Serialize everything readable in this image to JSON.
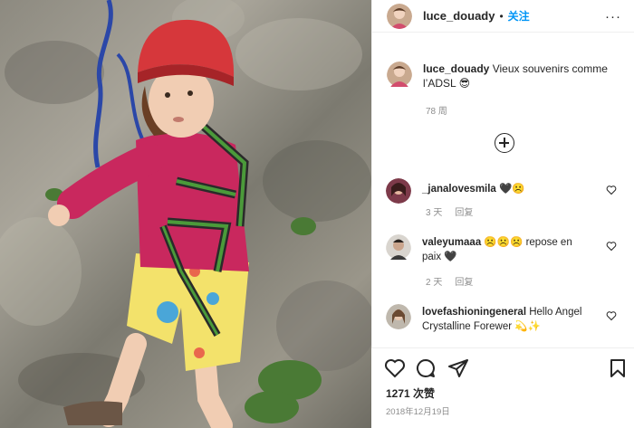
{
  "header": {
    "username": "luce_douady",
    "separator": "•",
    "follow_label": "关注",
    "more": "···"
  },
  "caption": {
    "username": "luce_douady",
    "text": "Vieux souvenirs comme l’ADSL 😎",
    "time": "78 周"
  },
  "comments": [
    {
      "username": "_janalovesmila",
      "text": "🖤☹️",
      "time": "3 天",
      "reply": "回复"
    },
    {
      "username": "valeyumaaa",
      "text": "☹️☹️☹️ repose en paix 🖤",
      "time": "2 天",
      "reply": "回复"
    },
    {
      "username": "lovefashioningeneral",
      "text": "Hello Angel Crystalline Forewer 💫✨"
    }
  ],
  "likes": "1271 次赞",
  "date": "2018年12月19日",
  "icons": {
    "like": "heart-icon",
    "comment": "comment-icon",
    "share": "share-icon",
    "save": "bookmark-icon",
    "load_more": "plus-circle-icon",
    "options": "more-icon"
  },
  "colors": {
    "accent": "#0095f6",
    "text": "#262626",
    "muted": "#8e8e8e"
  }
}
